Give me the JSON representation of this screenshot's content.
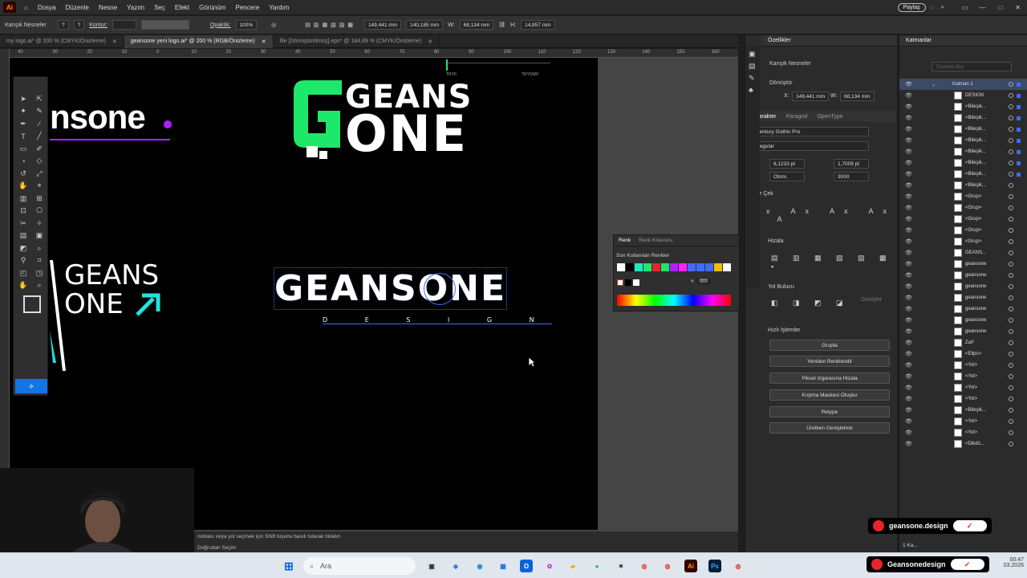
{
  "menubar": {
    "app_icon": "Ai",
    "items": [
      "Dosya",
      "Düzenle",
      "Nesne",
      "Yazım",
      "Seç",
      "Efekt",
      "Görünüm",
      "Pencere",
      "Yardım"
    ],
    "share_label": "Paylaş"
  },
  "controlbar": {
    "selection_label": "Karışık Nesneler",
    "stroke_label": "Kontur:",
    "opacity_label": "Opaklık:",
    "opacity_value": "100%",
    "x_value": "149,441 mm",
    "y_value": "140,185 mm",
    "w_label": "W:",
    "w_value": "68,134 mm",
    "h_label": "H:",
    "h_value": "14,857 mm"
  },
  "tabs": [
    {
      "label": "my logo.ai* @ 200 % (CMYK/Önizleme)",
      "active": false
    },
    {
      "label": "geansone yeni logo.ai* @ 200 % (RGB/Önizleme)",
      "active": true
    },
    {
      "label": "file [Dönüştürülmüş].eps* @ 184,89 % (CMYK/Önizleme)",
      "active": false
    }
  ],
  "ruler": {
    "top_ticks": [
      "40",
      "30",
      "20",
      "10",
      "0",
      "10",
      "20",
      "30",
      "40",
      "50",
      "60",
      "70",
      "80",
      "90",
      "100",
      "110",
      "120",
      "130",
      "140",
      "150",
      "160"
    ]
  },
  "artboard": {
    "logo_top_line1": "GEANS",
    "logo_top_line2": "ONE",
    "logo_left_partial": "nsone",
    "logo_mid_line1": "GEANS",
    "logo_mid_line2": "ONE",
    "logo_center_main": "GEANSONE",
    "logo_center_sub": "D E S I G N",
    "try_label_1": "TRY0",
    "try_label_2": "TRY5000",
    "brand_green": "#1ee86a",
    "brand_purple": "#b020ff",
    "brand_cyan": "#22e0e0"
  },
  "status": {
    "hint": "noktası veya yol seçmek için Shift tuşunu basılı tutarak tıklatın",
    "selection": "Doğrudan Seçim"
  },
  "color_panel": {
    "tab1": "Renk",
    "tab2": "Renk Kılavuzu",
    "recent_label": "Son Kullanılan Renkler",
    "hex_label": "#",
    "hex_value": "ffffff",
    "swatches": [
      "#ffffff",
      "#000000",
      "#1ee8c0",
      "#1ee86a",
      "#e8242a",
      "#1ee86a",
      "#b020ff",
      "#ff20ff",
      "#3d6cff",
      "#3d6cff",
      "#3d6cff",
      "#f0c000",
      "#ffffff"
    ]
  },
  "props": {
    "title": "Özellikler",
    "selection_type": "Karışık Nesneler",
    "transform_label": "Dönüştür",
    "x_label": "X:",
    "x_value": "149,441 mm",
    "w_label": "W:",
    "w_value": "68,134 mm",
    "char_tabs": [
      "Karakter",
      "Paragraf",
      "OpenType"
    ],
    "font_family": "Century Gothic Pro",
    "font_style": "Regular",
    "font_size": "6,1233 pt",
    "leading": "1,7009 pt",
    "kerning": "Otom.",
    "tracking": "3000",
    "glyph_label": "Glife Çek",
    "align_label": "Hizala",
    "pathfinder_label": "Yol Bulucu",
    "expand_label": "Genişlet",
    "quick_actions_label": "Hızlı İşlemler",
    "actions": [
      "Grupla",
      "Yeniden Renklendir",
      "Piksel Izgarasına Hizala",
      "Kırpma Maskesi Oluştur",
      "Retype",
      "Üretken Genişletme"
    ]
  },
  "layers": {
    "title": "Katmanlar",
    "search_placeholder": "Tümünü Bul",
    "layer_name": "Katman 1",
    "rows": [
      "DESIGN",
      "<Bileşik...",
      "<Bileşik...",
      "<Bileşik...",
      "<Bileşik...",
      "<Bileşik...",
      "<Bileşik...",
      "<Bileşik...",
      "<Bileşik...",
      "<Grup>",
      "<Grup>",
      "<Grup>",
      "<Grup>",
      "<Grup>",
      "GEANS...",
      "geansone",
      "geansone",
      "geansone",
      "geansone",
      "geansone",
      "geansone",
      "geansone",
      "Zarf",
      "<Elips>",
      "<Yol>",
      "<Yol>",
      "<Yol>",
      "<Yol>",
      "<Bileşik...",
      "<Yol>",
      "<Yol>",
      "<Dikdö..."
    ],
    "footer_count": "1 Ka..."
  },
  "overlays": {
    "badge_top": "geansone.design",
    "badge_bottom": "Geansonedesign",
    "check_mark": "✓"
  },
  "taskbar": {
    "search_placeholder": "Ara",
    "clock_time": "00:47",
    "clock_date": "03.2026"
  }
}
